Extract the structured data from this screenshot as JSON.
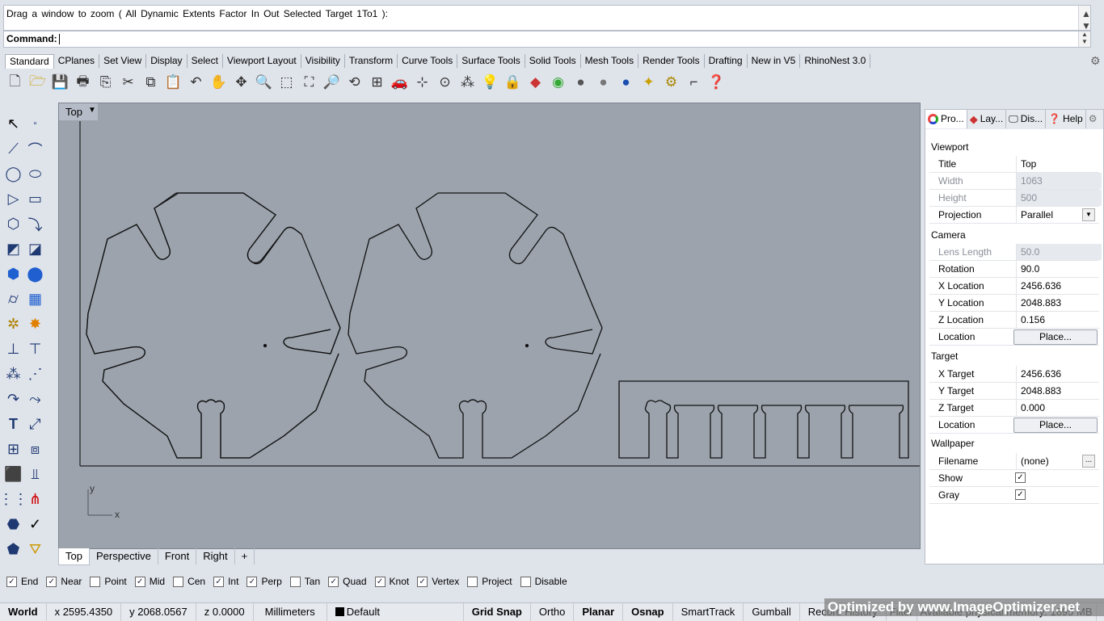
{
  "command": {
    "history": "Drag a window to zoom ( All  Dynamic  Extents  Factor  In  Out  Selected  Target  1To1 ):",
    "prompt": "Command:"
  },
  "toolbar_tabs": [
    "Standard",
    "CPlanes",
    "Set View",
    "Display",
    "Select",
    "Viewport Layout",
    "Visibility",
    "Transform",
    "Curve Tools",
    "Surface Tools",
    "Solid Tools",
    "Mesh Tools",
    "Render Tools",
    "Drafting",
    "New in V5",
    "RhinoNest 3.0"
  ],
  "viewport": {
    "title": "Top",
    "axis_x": "x",
    "axis_y": "y"
  },
  "viewport_tabs": [
    "Top",
    "Perspective",
    "Front",
    "Right",
    "+"
  ],
  "osnaps": [
    {
      "label": "End",
      "checked": true
    },
    {
      "label": "Near",
      "checked": true
    },
    {
      "label": "Point",
      "checked": false
    },
    {
      "label": "Mid",
      "checked": true
    },
    {
      "label": "Cen",
      "checked": false
    },
    {
      "label": "Int",
      "checked": true
    },
    {
      "label": "Perp",
      "checked": true
    },
    {
      "label": "Tan",
      "checked": false
    },
    {
      "label": "Quad",
      "checked": true
    },
    {
      "label": "Knot",
      "checked": true
    },
    {
      "label": "Vertex",
      "checked": true
    },
    {
      "label": "Project",
      "checked": false
    },
    {
      "label": "Disable",
      "checked": false
    }
  ],
  "status": {
    "cplane": "World",
    "x": "x 2595.4350",
    "y": "y 2068.0567",
    "z": "z 0.0000",
    "units": "Millimeters",
    "layer": "Default",
    "grid_snap": "Grid Snap",
    "ortho": "Ortho",
    "planar": "Planar",
    "osnap": "Osnap",
    "smarttrack": "SmartTrack",
    "gumball": "Gumball",
    "record_history": "Record History",
    "filter": "Filter",
    "memory": "Available physical memory: 1895 MB",
    "watermark": "Optimized by www.ImageOptimizer.net"
  },
  "panel": {
    "tabs": [
      "Pro...",
      "Lay...",
      "Dis...",
      "Help"
    ],
    "viewport_header": "Viewport",
    "title_label": "Title",
    "title_value": "Top",
    "width_label": "Width",
    "width_value": "1063",
    "height_label": "Height",
    "height_value": "500",
    "projection_label": "Projection",
    "projection_value": "Parallel",
    "camera_header": "Camera",
    "lens_label": "Lens Length",
    "lens_value": "50.0",
    "rotation_label": "Rotation",
    "rotation_value": "90.0",
    "cam_x_label": "X Location",
    "cam_x_value": "2456.636",
    "cam_y_label": "Y Location",
    "cam_y_value": "2048.883",
    "cam_z_label": "Z Location",
    "cam_z_value": "0.156",
    "cam_loc_label": "Location",
    "cam_loc_button": "Place...",
    "target_header": "Target",
    "tgt_x_label": "X Target",
    "tgt_x_value": "2456.636",
    "tgt_y_label": "Y Target",
    "tgt_y_value": "2048.883",
    "tgt_z_label": "Z Target",
    "tgt_z_value": "0.000",
    "tgt_loc_label": "Location",
    "tgt_loc_button": "Place...",
    "wallpaper_header": "Wallpaper",
    "filename_label": "Filename",
    "filename_value": "(none)",
    "filename_button": "...",
    "show_label": "Show",
    "show_checked": true,
    "gray_label": "Gray",
    "gray_checked": true
  }
}
